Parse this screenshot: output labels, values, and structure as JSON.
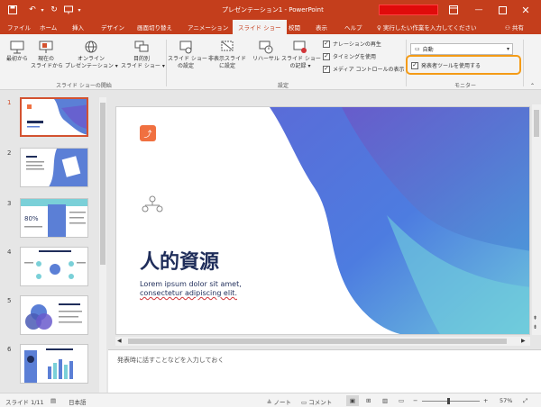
{
  "app": {
    "window_title": "プレゼンテーション1 - PowerPoint",
    "signin_icon": "restore-ribbon-icon"
  },
  "tabs": [
    "ファイル",
    "ホーム",
    "挿入",
    "デザイン",
    "画面切り替え",
    "アニメーション",
    "スライド ショー",
    "校閲",
    "表示",
    "ヘルプ"
  ],
  "tellme": "実行したい作業を入力してください",
  "share": "共有",
  "ribbon": {
    "from_start": [
      "最初から"
    ],
    "from_current": [
      "現在の",
      "スライドから"
    ],
    "online": [
      "オンライン",
      "プレゼンテーション ▾"
    ],
    "custom": [
      "目的別",
      "スライド ショー ▾"
    ],
    "group_start": "スライド ショーの開始",
    "setup": [
      "スライド ショー",
      "の設定"
    ],
    "hide": [
      "非表示スライド",
      "に設定"
    ],
    "rehearse": "リハーサル",
    "record": [
      "スライド ショー",
      "の記録 ▾"
    ],
    "chk_narration": "ナレーションの再生",
    "chk_timing": "タイミングを使用",
    "chk_media": "メディア コントロールの表示",
    "group_setup": "設定",
    "monitor_value": "自動",
    "presenter_view": "発表者ツールを使用する",
    "group_monitor": "モニター"
  },
  "thumbnails": [
    "1",
    "2",
    "3",
    "4",
    "5",
    "6"
  ],
  "slide": {
    "title": "人的資源",
    "body_line1": "Lorem ipsum dolor sit amet,",
    "body_line2": "consectetur adipiscing elit."
  },
  "notes_placeholder": "発表時に話すことなどを入力しておく",
  "status": {
    "slide_count": "スライド 1/11",
    "language": "日本語",
    "notes": "ノート",
    "comments": "コメント",
    "zoom": "57%"
  },
  "colors": {
    "accent": "#c43e1c",
    "highlight": "#f49b16",
    "slide_title": "#1f2d5a"
  }
}
